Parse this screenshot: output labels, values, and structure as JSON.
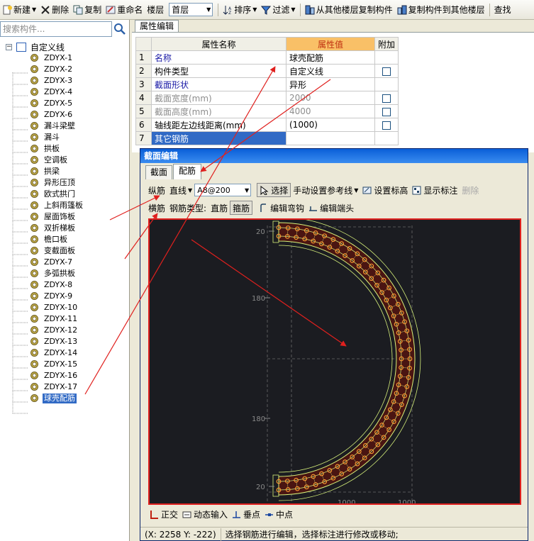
{
  "toolbar": {
    "new": "新建",
    "delete": "删除",
    "copy": "复制",
    "rename": "重命名",
    "floor_label": "楼层",
    "floor_value": "首层",
    "sort": "排序",
    "filter": "过滤",
    "copy_from_other": "从其他楼层复制构件",
    "copy_to_other": "复制构件到其他楼层",
    "search_more": "查找"
  },
  "search": {
    "placeholder": "搜索构件..."
  },
  "tree": {
    "root": "自定义线",
    "items": [
      "ZDYX-1",
      "ZDYX-2",
      "ZDYX-3",
      "ZDYX-4",
      "ZDYX-5",
      "ZDYX-6",
      "漏斗梁壁",
      "漏斗",
      "拱板",
      "空调板",
      "拱梁",
      "异形压顶",
      "欧式拱门",
      "上斜雨篷板",
      "屋面饰板",
      "双折梯板",
      "檐口板",
      "变截面板",
      "ZDYX-7",
      "多弧拱板",
      "ZDYX-8",
      "ZDYX-9",
      "ZDYX-10",
      "ZDYX-11",
      "ZDYX-12",
      "ZDYX-13",
      "ZDYX-14",
      "ZDYX-15",
      "ZDYX-16",
      "ZDYX-17",
      "球壳配筋"
    ],
    "selected_index": 30
  },
  "property_editor": {
    "tab": "属性编辑",
    "headers": {
      "name": "属性名称",
      "value": "属性值",
      "extra": "附加"
    },
    "rows": [
      {
        "num": "1",
        "name": "名称",
        "value": "球壳配筋",
        "has_check": false,
        "style": "blue"
      },
      {
        "num": "2",
        "name": "构件类型",
        "value": "自定义线",
        "has_check": true,
        "style": "normal"
      },
      {
        "num": "3",
        "name": "截面形状",
        "value": "异形",
        "has_check": false,
        "style": "blue"
      },
      {
        "num": "4",
        "name": "截面宽度(mm)",
        "value": "2000",
        "has_check": true,
        "style": "gray"
      },
      {
        "num": "5",
        "name": "截面高度(mm)",
        "value": "4000",
        "has_check": true,
        "style": "gray"
      },
      {
        "num": "6",
        "name": "轴线距左边线距离(mm)",
        "value": "(1000)",
        "has_check": true,
        "style": "normal"
      },
      {
        "num": "7",
        "name": "其它钢筋",
        "value": "",
        "has_check": false,
        "style": "selected"
      }
    ]
  },
  "section_editor": {
    "title": "截面编辑",
    "tabs": [
      "截面",
      "配筋"
    ],
    "active_tab": "配筋",
    "toolbar1": {
      "longitudinal": "纵筋",
      "line_type": "直线",
      "rebar_spec": "A8@200",
      "select": "选择",
      "manual_ref": "手动设置参考线",
      "set_label": "设置标高",
      "show_label": "显示标注",
      "delete": "删除"
    },
    "toolbar2": {
      "transverse": "横筋",
      "rebar_type_label": "钢筋类型:",
      "straight": "直筋",
      "stirrup": "箍筋",
      "edit_hook": "编辑弯钩",
      "edit_end": "编辑端头"
    },
    "canvas_labels": [
      "20",
      "180",
      "180",
      "20",
      "1000",
      "1000"
    ],
    "bottombar": {
      "orthogonal": "正交",
      "dynamic_input": "动态输入",
      "perpendicular": "垂点",
      "midpoint": "中点"
    },
    "status": {
      "coords": "(X: 2258 Y: -222)",
      "message": "选择钢筋进行编辑，选择标注进行修改或移动;"
    }
  },
  "colors": {
    "selection": "#316ac5",
    "canvas_bg": "#1b1c21",
    "rebar_fill": "#4a1512",
    "rebar_circle": "#ff9c32",
    "outline": "#d6f07a",
    "annotation": "#e0201e"
  }
}
